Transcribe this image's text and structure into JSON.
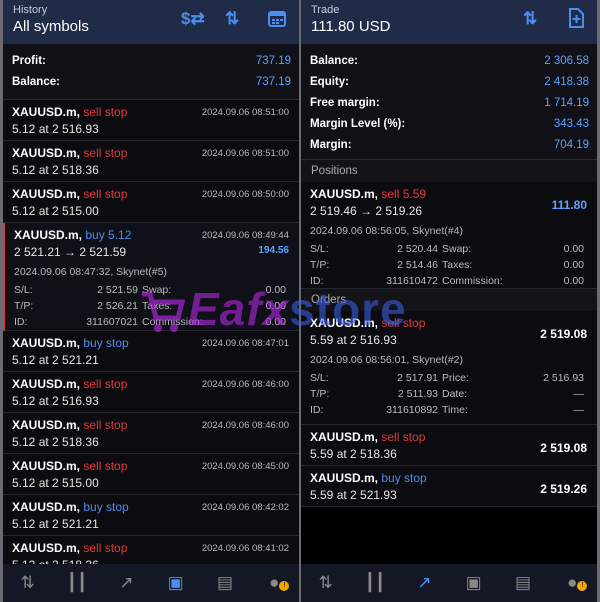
{
  "history": {
    "subtitle": "History",
    "title": "All symbols",
    "summary": [
      {
        "label": "Profit:",
        "value": "737.19"
      },
      {
        "label": "Balance:",
        "value": "737.19"
      }
    ],
    "deals": [
      {
        "symbol": "XAUUSD.m,",
        "side": "sell stop",
        "color": "red",
        "vol": "5.12 at 2 516.93",
        "time": "2024.09.06 08:51:00"
      },
      {
        "symbol": "XAUUSD.m,",
        "side": "sell stop",
        "color": "red",
        "vol": "5.12 at 2 518.36",
        "time": "2024.09.06 08:51:00"
      },
      {
        "symbol": "XAUUSD.m,",
        "side": "sell stop",
        "color": "red",
        "vol": "5.12 at 2 515.00",
        "time": "2024.09.06 08:50:00"
      }
    ],
    "expanded": {
      "symbol": "XAUUSD.m,",
      "side": "buy 5.12",
      "prices": "2 521.21 → 2 521.59",
      "time": "2024.09.06 08:49:44",
      "profit": "194.56",
      "info": "2024.09.06 08:47:32, Skynet(#5)",
      "sl_label": "S/L:",
      "sl": "2 521.59",
      "swap_label": "Swap:",
      "swap": "0.00",
      "tp_label": "T/P:",
      "tp": "2 526.21",
      "taxes_label": "Taxes:",
      "taxes": "0.00",
      "id_label": "ID:",
      "id": "311607021",
      "comm_label": "Commission:",
      "comm": "0.00"
    },
    "deals2": [
      {
        "symbol": "XAUUSD.m,",
        "side": "buy stop",
        "color": "blue",
        "vol": "5.12 at 2 521.21",
        "time": "2024.09.06 08:47:01"
      },
      {
        "symbol": "XAUUSD.m,",
        "side": "sell stop",
        "color": "red",
        "vol": "5.12 at 2 516.93",
        "time": "2024.09.06 08:46:00"
      },
      {
        "symbol": "XAUUSD.m,",
        "side": "sell stop",
        "color": "red",
        "vol": "5.12 at 2 518.36",
        "time": "2024.09.06 08:46:00"
      },
      {
        "symbol": "XAUUSD.m,",
        "side": "sell stop",
        "color": "red",
        "vol": "5.12 at 2 515.00",
        "time": "2024.09.06 08:45:00"
      },
      {
        "symbol": "XAUUSD.m,",
        "side": "buy stop",
        "color": "blue",
        "vol": "5.12 at 2 521.21",
        "time": "2024.09.06 08:42:02"
      },
      {
        "symbol": "XAUUSD.m,",
        "side": "sell stop",
        "color": "red",
        "vol": "5.12 at 2 518.36",
        "time": "2024.09.06 08:41:02"
      }
    ]
  },
  "trade": {
    "subtitle": "Trade",
    "title": "111.80 USD",
    "summary": [
      {
        "label": "Balance:",
        "value": "2 306.58"
      },
      {
        "label": "Equity:",
        "value": "2 418.38"
      },
      {
        "label": "Free margin:",
        "value": "1 714.19"
      },
      {
        "label": "Margin Level (%):",
        "value": "343.43"
      },
      {
        "label": "Margin:",
        "value": "704.19"
      }
    ],
    "positions_header": "Positions",
    "position": {
      "symbol": "XAUUSD.m,",
      "side": "sell 5.59",
      "prices": "2 519.46 → 2 519.26",
      "profit": "111.80",
      "info": "2024.09.06 08:56:05, Skynet(#4)",
      "sl_label": "S/L:",
      "sl": "2 520.44",
      "swap_label": "Swap:",
      "swap": "0.00",
      "tp_label": "T/P:",
      "tp": "2 514.46",
      "taxes_label": "Taxes:",
      "taxes": "0.00",
      "id_label": "ID:",
      "id": "311610472",
      "comm_label": "Commission:",
      "comm": "0.00"
    },
    "orders_header": "Orders",
    "order_expanded": {
      "symbol": "XAUUSD.m,",
      "side": "sell stop",
      "vol": "5.59 at 2 516.93",
      "price_right": "2 519.08",
      "info": "2024.09.06 08:56:01, Skynet(#2)",
      "sl_label": "S/L:",
      "sl": "2 517.91",
      "price_label": "Price:",
      "price": "2 516.93",
      "tp_label": "T/P:",
      "tp": "2 511.93",
      "date_label": "Date:",
      "date": "—",
      "id_label": "ID:",
      "id": "311610892",
      "time_label": "Time:",
      "time": "—"
    },
    "orders": [
      {
        "symbol": "XAUUSD.m,",
        "side": "sell stop",
        "color": "red",
        "vol": "5.59 at 2 518.36",
        "price": "2 519.08"
      },
      {
        "symbol": "XAUUSD.m,",
        "side": "buy stop",
        "color": "blue",
        "vol": "5.59 at 2 521.93",
        "price": "2 519.26"
      }
    ]
  },
  "watermark": {
    "part1": "Eafx",
    "part2": "store"
  },
  "colors": {
    "accent": "#4d8cf0",
    "sell": "#e23b3b",
    "header": "#1f2b47",
    "badge": "#f2a600"
  },
  "nav_icons": [
    "quotes-icon",
    "chart-icon",
    "trade-icon",
    "history-icon",
    "news-icon",
    "messages-icon"
  ]
}
